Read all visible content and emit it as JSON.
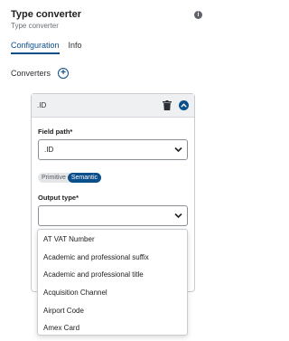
{
  "header": {
    "title": "Type converter",
    "subtitle": "Type converter"
  },
  "tabs": [
    {
      "label": "Configuration",
      "active": true
    },
    {
      "label": "Info",
      "active": false
    }
  ],
  "converters": {
    "label": "Converters"
  },
  "card": {
    "name": ".ID",
    "field_path": {
      "label": "Field path*",
      "value": ".ID"
    },
    "mode_toggle": {
      "options": [
        "Primitive",
        "Semantic"
      ],
      "selected": "Semantic"
    },
    "output_type": {
      "label": "Output type*",
      "value": ""
    }
  },
  "dropdown": {
    "options": [
      "AT VAT Number",
      "Academic and professional suffix",
      "Academic and professional title",
      "Acquisition Channel",
      "Airport Code",
      "Amex Card"
    ]
  },
  "colors": {
    "accent": "#0b4f8a",
    "header_bg": "#eef0f2"
  }
}
